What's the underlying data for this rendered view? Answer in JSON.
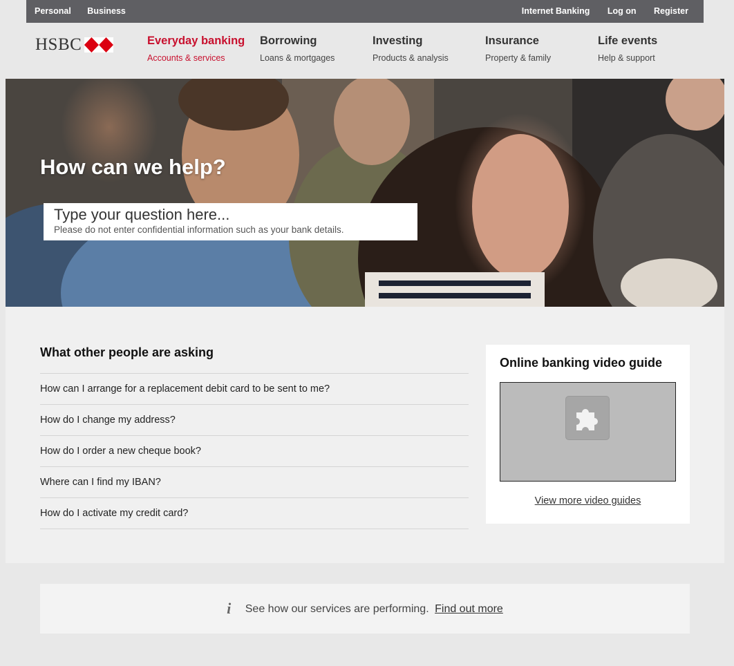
{
  "topbar": {
    "left": [
      "Personal",
      "Business"
    ],
    "right": [
      "Internet Banking",
      "Log on",
      "Register"
    ]
  },
  "logo": {
    "text": "HSBC",
    "icon": "hsbc-hexagon-icon",
    "brand_red": "#db0011"
  },
  "nav": [
    {
      "title": "Everyday banking",
      "sub": "Accounts & services",
      "active": true
    },
    {
      "title": "Borrowing",
      "sub": "Loans & mortgages"
    },
    {
      "title": "Investing",
      "sub": "Products & analysis"
    },
    {
      "title": "Insurance",
      "sub": "Property & family"
    },
    {
      "title": "Life events",
      "sub": "Help & support"
    }
  ],
  "hero": {
    "heading": "How can we help?",
    "search_placeholder": "Type your question here...",
    "search_note": "Please do not enter confidential information such as your bank details."
  },
  "faq": {
    "heading": "What other people are asking",
    "items": [
      "How can I arrange for a replacement debit card to be sent to me?",
      "How do I change my address?",
      "How do I order a new cheque book?",
      "Where can I find my IBAN?",
      "How do I activate my credit card?"
    ]
  },
  "video": {
    "heading": "Online banking video guide",
    "plugin_icon": "puzzle-piece-icon",
    "more_link": "View more video guides"
  },
  "notice": {
    "icon": "info-icon",
    "text": "See how our services are performing.",
    "link": "Find out more"
  },
  "colors": {
    "accent": "#c8102e",
    "topbar": "#5f5f63",
    "background": "#e8e8e8"
  }
}
